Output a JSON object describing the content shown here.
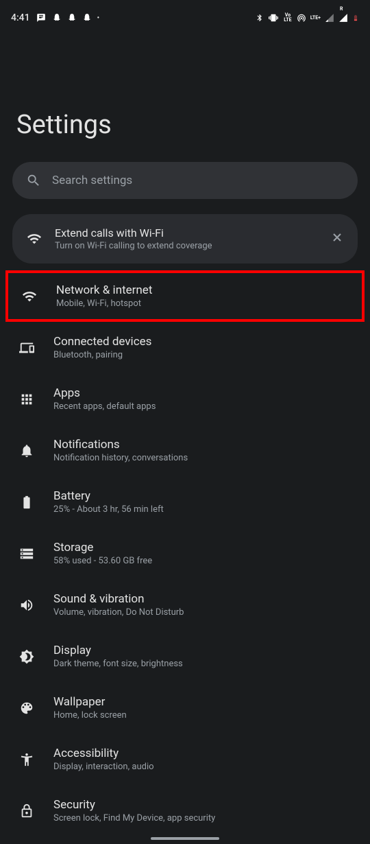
{
  "status_bar": {
    "time": "4:41",
    "lte_label": "LTE+",
    "volte_label": "Vo LTE",
    "roam_label": "R"
  },
  "page": {
    "title": "Settings"
  },
  "search": {
    "placeholder": "Search settings"
  },
  "suggestion": {
    "title": "Extend calls with Wi-Fi",
    "subtitle": "Turn on Wi-Fi calling to extend coverage"
  },
  "items": [
    {
      "title": "Network & internet",
      "subtitle": "Mobile, Wi-Fi, hotspot"
    },
    {
      "title": "Connected devices",
      "subtitle": "Bluetooth, pairing"
    },
    {
      "title": "Apps",
      "subtitle": "Recent apps, default apps"
    },
    {
      "title": "Notifications",
      "subtitle": "Notification history, conversations"
    },
    {
      "title": "Battery",
      "subtitle": "25% - About 3 hr, 56 min left"
    },
    {
      "title": "Storage",
      "subtitle": "58% used - 53.60 GB free"
    },
    {
      "title": "Sound & vibration",
      "subtitle": "Volume, vibration, Do Not Disturb"
    },
    {
      "title": "Display",
      "subtitle": "Dark theme, font size, brightness"
    },
    {
      "title": "Wallpaper",
      "subtitle": "Home, lock screen"
    },
    {
      "title": "Accessibility",
      "subtitle": "Display, interaction, audio"
    },
    {
      "title": "Security",
      "subtitle": "Screen lock, Find My Device, app security"
    }
  ]
}
